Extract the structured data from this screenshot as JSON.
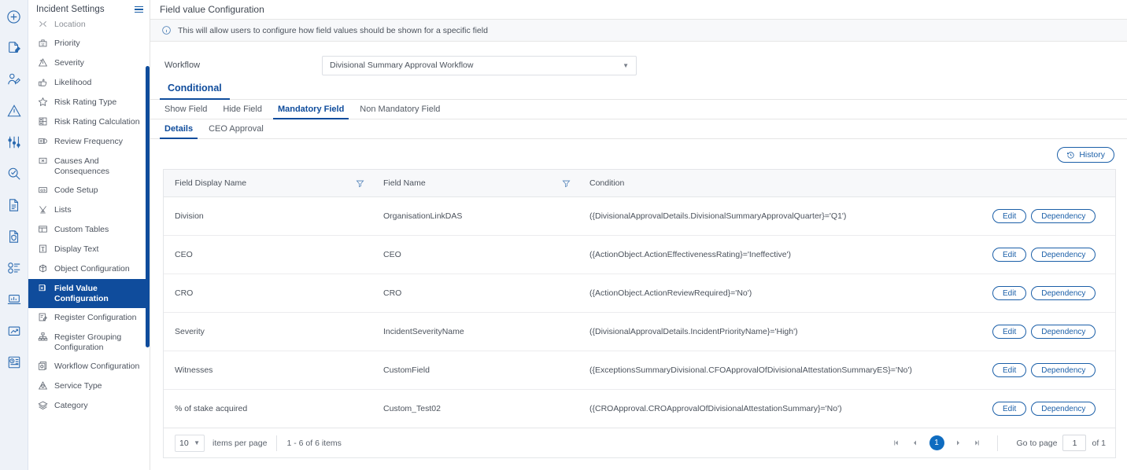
{
  "rail": {
    "icons": [
      "plus-circle-icon",
      "document-edit-icon",
      "user-edit-icon",
      "warning-triangle-icon",
      "sliders-icon",
      "search-check-icon",
      "document-lines-icon",
      "document-shield-icon",
      "list-settings-icon",
      "laptop-chart-icon",
      "trend-chart-icon",
      "clock-list-icon"
    ]
  },
  "sidebar": {
    "title": "Incident Settings",
    "menu_icon": "hamburger-icon",
    "items": [
      {
        "label": "Location",
        "icon": "location-icon",
        "active": false,
        "clipped": true
      },
      {
        "label": "Priority",
        "icon": "priority-icon",
        "active": false
      },
      {
        "label": "Severity",
        "icon": "severity-icon",
        "active": false
      },
      {
        "label": "Likelihood",
        "icon": "likelihood-icon",
        "active": false
      },
      {
        "label": "Risk Rating Type",
        "icon": "star-icon",
        "active": false
      },
      {
        "label": "Risk Rating Calculation",
        "icon": "grid-icon",
        "active": false
      },
      {
        "label": "Review Frequency",
        "icon": "review-icon",
        "active": false
      },
      {
        "label": "Causes And Consequences",
        "icon": "causes-icon",
        "active": false
      },
      {
        "label": "Code Setup",
        "icon": "code-icon",
        "active": false
      },
      {
        "label": "Lists",
        "icon": "lists-icon",
        "active": false
      },
      {
        "label": "Custom Tables",
        "icon": "table-icon",
        "active": false
      },
      {
        "label": "Display Text",
        "icon": "text-icon",
        "active": false
      },
      {
        "label": "Object Configuration",
        "icon": "object-config-icon",
        "active": false
      },
      {
        "label": "Field Value Configuration",
        "icon": "field-value-icon",
        "active": true
      },
      {
        "label": "Register Configuration",
        "icon": "register-config-icon",
        "active": false
      },
      {
        "label": "Register Grouping Configuration",
        "icon": "register-grouping-icon",
        "active": false
      },
      {
        "label": "Workflow Configuration",
        "icon": "workflow-config-icon",
        "active": false
      },
      {
        "label": "Service Type",
        "icon": "service-type-icon",
        "active": false
      },
      {
        "label": "Category",
        "icon": "category-icon",
        "active": false
      }
    ]
  },
  "header": {
    "page_title": "Field value Configuration",
    "info_icon": "info-circle-icon",
    "info_text": "This will allow users to configure how field values should be shown for a specific field"
  },
  "workflow": {
    "label": "Workflow",
    "selected": "Divisional Summary Approval Workflow",
    "caret_icon": "chevron-down-icon"
  },
  "tabs_level1": [
    {
      "label": "Conditional",
      "selected": true
    }
  ],
  "tabs_level2": [
    {
      "label": "Show Field",
      "selected": false
    },
    {
      "label": "Hide Field",
      "selected": false
    },
    {
      "label": "Mandatory Field",
      "selected": true
    },
    {
      "label": "Non Mandatory Field",
      "selected": false
    }
  ],
  "tabs_level3": [
    {
      "label": "Details",
      "selected": true
    },
    {
      "label": "CEO Approval",
      "selected": false
    }
  ],
  "toolbar": {
    "history_label": "History",
    "history_icon": "history-clock-icon"
  },
  "table": {
    "columns": [
      {
        "label": "Field Display Name",
        "filter": true,
        "filter_icon": "filter-funnel-icon"
      },
      {
        "label": "Field Name",
        "filter": true,
        "filter_icon": "filter-funnel-icon"
      },
      {
        "label": "Condition",
        "filter": false
      },
      {
        "label": "",
        "filter": false
      }
    ],
    "row_actions": {
      "edit_label": "Edit",
      "dependency_label": "Dependency"
    },
    "rows": [
      {
        "display_name": "Division",
        "field_name": "OrganisationLinkDAS",
        "condition": "({DivisionalApprovalDetails.DivisionalSummaryApprovalQuarter}='Q1')"
      },
      {
        "display_name": "CEO",
        "field_name": "CEO",
        "condition": "({ActionObject.ActionEffectivenessRating}='Ineffective')"
      },
      {
        "display_name": "CRO",
        "field_name": "CRO",
        "condition": "({ActionObject.ActionReviewRequired}='No')"
      },
      {
        "display_name": "Severity",
        "field_name": "IncidentSeverityName",
        "condition": "({DivisionalApprovalDetails.IncidentPriorityName}='High')"
      },
      {
        "display_name": "Witnesses",
        "field_name": "CustomField",
        "condition": "({ExceptionsSummaryDivisional.CFOApprovalOfDivisionalAttestationSummaryES}='No')"
      },
      {
        "display_name": "% of stake acquired",
        "field_name": "Custom_Test02",
        "condition": "({CROApproval.CROApprovalOfDivisionalAttestationSummary}='No')"
      }
    ]
  },
  "pagination": {
    "page_size": "10",
    "page_size_caret": "chevron-down-icon",
    "items_per_page_label": "items per page",
    "range_text": "1 - 6 of 6 items",
    "first_icon": "first-page-icon",
    "prev_icon": "prev-page-icon",
    "current_page": "1",
    "next_icon": "next-page-icon",
    "last_icon": "last-page-icon",
    "goto_label": "Go to page",
    "goto_value": "1",
    "of_label": "of 1"
  },
  "colors": {
    "brand_blue": "#0f4c9c",
    "accent_blue": "#1b5fa8",
    "rail_bg": "#eef2f8",
    "header_bg": "#f7f8fa"
  }
}
